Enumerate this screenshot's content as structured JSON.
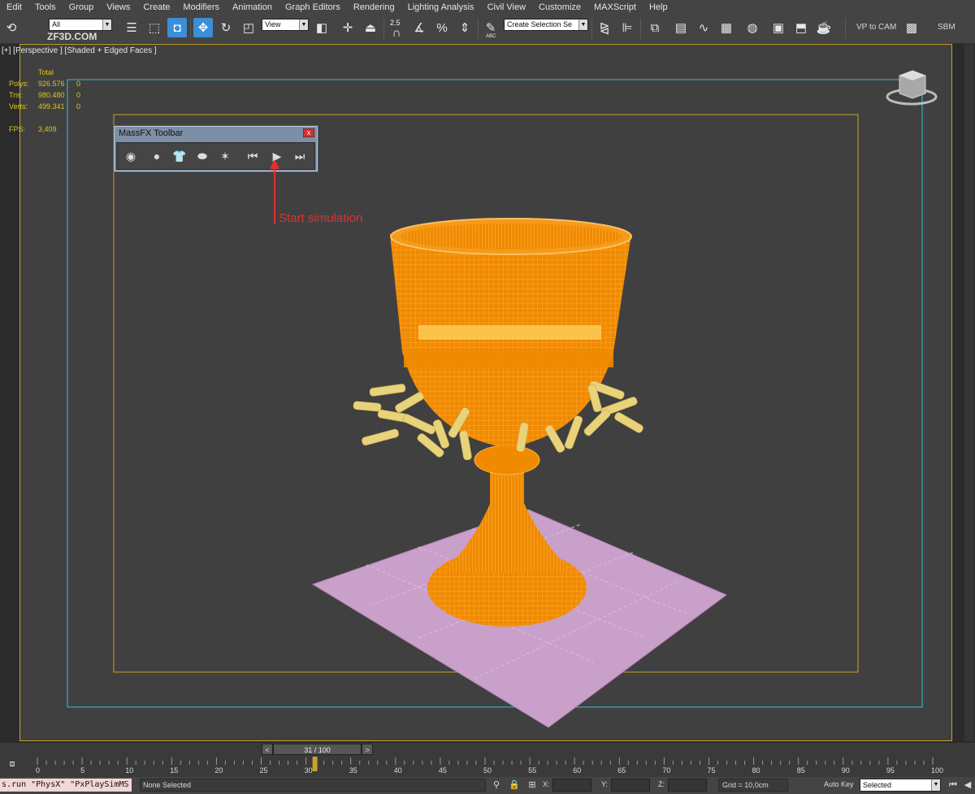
{
  "menu": {
    "items": [
      "Edit",
      "Tools",
      "Group",
      "Views",
      "Create",
      "Modifiers",
      "Animation",
      "Graph Editors",
      "Rendering",
      "Lighting Analysis",
      "Civil View",
      "Customize",
      "MAXScript",
      "Help"
    ]
  },
  "toolbar": {
    "watermark_text": "ZF3D.COM",
    "selection_filter": "All",
    "reference_coord": "View",
    "snap_value": "2.5",
    "named_selection_set": "Create Selection Se",
    "vp_to_cam_label": "VP to CAM",
    "sbm_label": "SBM",
    "abc_label": "ABC"
  },
  "viewport": {
    "label": "[+] [Perspective ] [Shaded + Edged Faces ]",
    "stats": {
      "header": "Total",
      "polys_label": "Polys:",
      "polys_value": "926.576",
      "polys_sel": "0",
      "tris_label": "Tris:",
      "tris_value": "980.480",
      "tris_sel": "0",
      "verts_label": "Verts:",
      "verts_value": "499.341",
      "verts_sel": "0",
      "fps_label": "FPS:",
      "fps_value": "3,409"
    },
    "accent_colors": {
      "safe_frame_outer": "#2ec4cf",
      "safe_frame_inner": "#c9a227",
      "wireframe": "#f28c00",
      "particles": "#e8d27a",
      "ground_plane": "#c9a0c9"
    }
  },
  "massfx": {
    "title": "MassFX Toolbar",
    "close_label": "x"
  },
  "annotation": {
    "text": "Start simulation",
    "color": "#e03030"
  },
  "timeline": {
    "frame_indicator": "31 / 100",
    "prev_label": "<",
    "next_label": ">",
    "ticks": [
      "0",
      "5",
      "10",
      "15",
      "20",
      "25",
      "30",
      "35",
      "40",
      "45",
      "50",
      "55",
      "60",
      "65",
      "70",
      "75",
      "80",
      "85",
      "90",
      "95",
      "100"
    ]
  },
  "statusbar": {
    "maxscript_text": "s.run \"PhysX\" \"PxPlaySimMS",
    "prompt": "None Selected",
    "x_label": "X:",
    "y_label": "Y:",
    "z_label": "Z:",
    "grid_text": "Grid = 10,0cm",
    "autokey_label": "Auto Key",
    "selected_value": "Selected"
  }
}
